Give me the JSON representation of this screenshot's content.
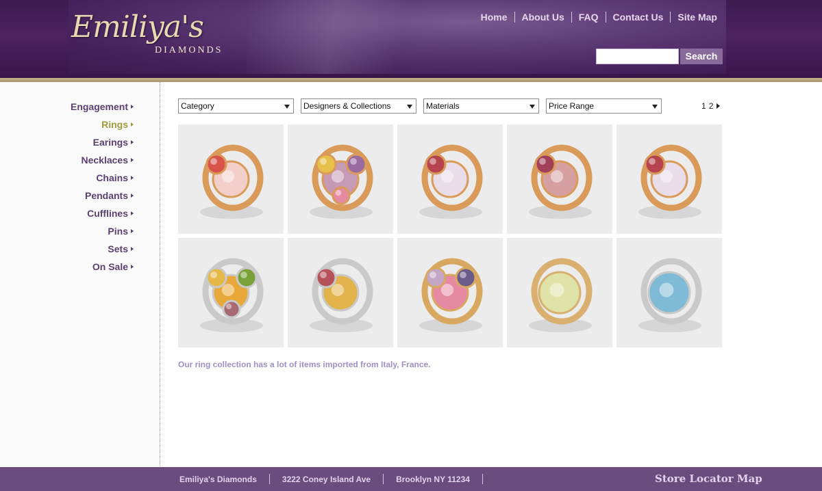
{
  "logo": {
    "script": "Emiliya's",
    "sub": "DIAMONDS"
  },
  "nav": [
    "Home",
    "About Us",
    "FAQ",
    "Contact Us",
    "Site Map"
  ],
  "search": {
    "button": "Search",
    "value": ""
  },
  "sidebar": {
    "items": [
      {
        "label": "Engagement",
        "active": false
      },
      {
        "label": "Rings",
        "active": true
      },
      {
        "label": "Earings",
        "active": false
      },
      {
        "label": "Necklaces",
        "active": false
      },
      {
        "label": "Chains",
        "active": false
      },
      {
        "label": "Pendants",
        "active": false
      },
      {
        "label": "Cufflines",
        "active": false
      },
      {
        "label": "Pins",
        "active": false
      },
      {
        "label": "Sets",
        "active": false
      },
      {
        "label": "On Sale",
        "active": false
      }
    ]
  },
  "filters": [
    "Category",
    "Designers & Collections",
    "Materials",
    "Price Range"
  ],
  "pager": {
    "pages": [
      "1",
      "2"
    ]
  },
  "products": [
    {
      "name": "ring-1",
      "metal": "#d99a5a",
      "stones": [
        "#f2cfc8",
        "#d8544a"
      ]
    },
    {
      "name": "ring-2",
      "metal": "#d99a5a",
      "stones": [
        "#c69ab5",
        "#e6c04a",
        "#9a6aa0",
        "#e58aa0"
      ]
    },
    {
      "name": "ring-3",
      "metal": "#d99a5a",
      "stones": [
        "#e8dde8",
        "#b6444e"
      ]
    },
    {
      "name": "ring-4",
      "metal": "#d99a5a",
      "stones": [
        "#d6a0a0",
        "#a2405a"
      ]
    },
    {
      "name": "ring-5",
      "metal": "#d99a5a",
      "stones": [
        "#e8dde8",
        "#b6444e"
      ]
    },
    {
      "name": "ring-6",
      "metal": "#c9c9c9",
      "stones": [
        "#e9a83a",
        "#e6b84a",
        "#7aa03a",
        "#a86a72"
      ]
    },
    {
      "name": "ring-7",
      "metal": "#c9c9c9",
      "stones": [
        "#e2b34a",
        "#b6525a"
      ]
    },
    {
      "name": "ring-8",
      "metal": "#d9a860",
      "stones": [
        "#e68aa4",
        "#c4a6c6",
        "#6a5a8a"
      ]
    },
    {
      "name": "ring-9",
      "metal": "#d9b070",
      "stones": [
        "#dfe3a8"
      ]
    },
    {
      "name": "ring-10",
      "metal": "#c9c9c9",
      "stones": [
        "#7fbad6"
      ]
    }
  ],
  "caption": "Our ring collection has a lot of items imported from Italy, France.",
  "footer": {
    "items": [
      "Emiliya's Diamonds",
      "3222 Coney Island Ave",
      "Brooklyn NY 11234"
    ],
    "map": "Store Locator Map"
  }
}
